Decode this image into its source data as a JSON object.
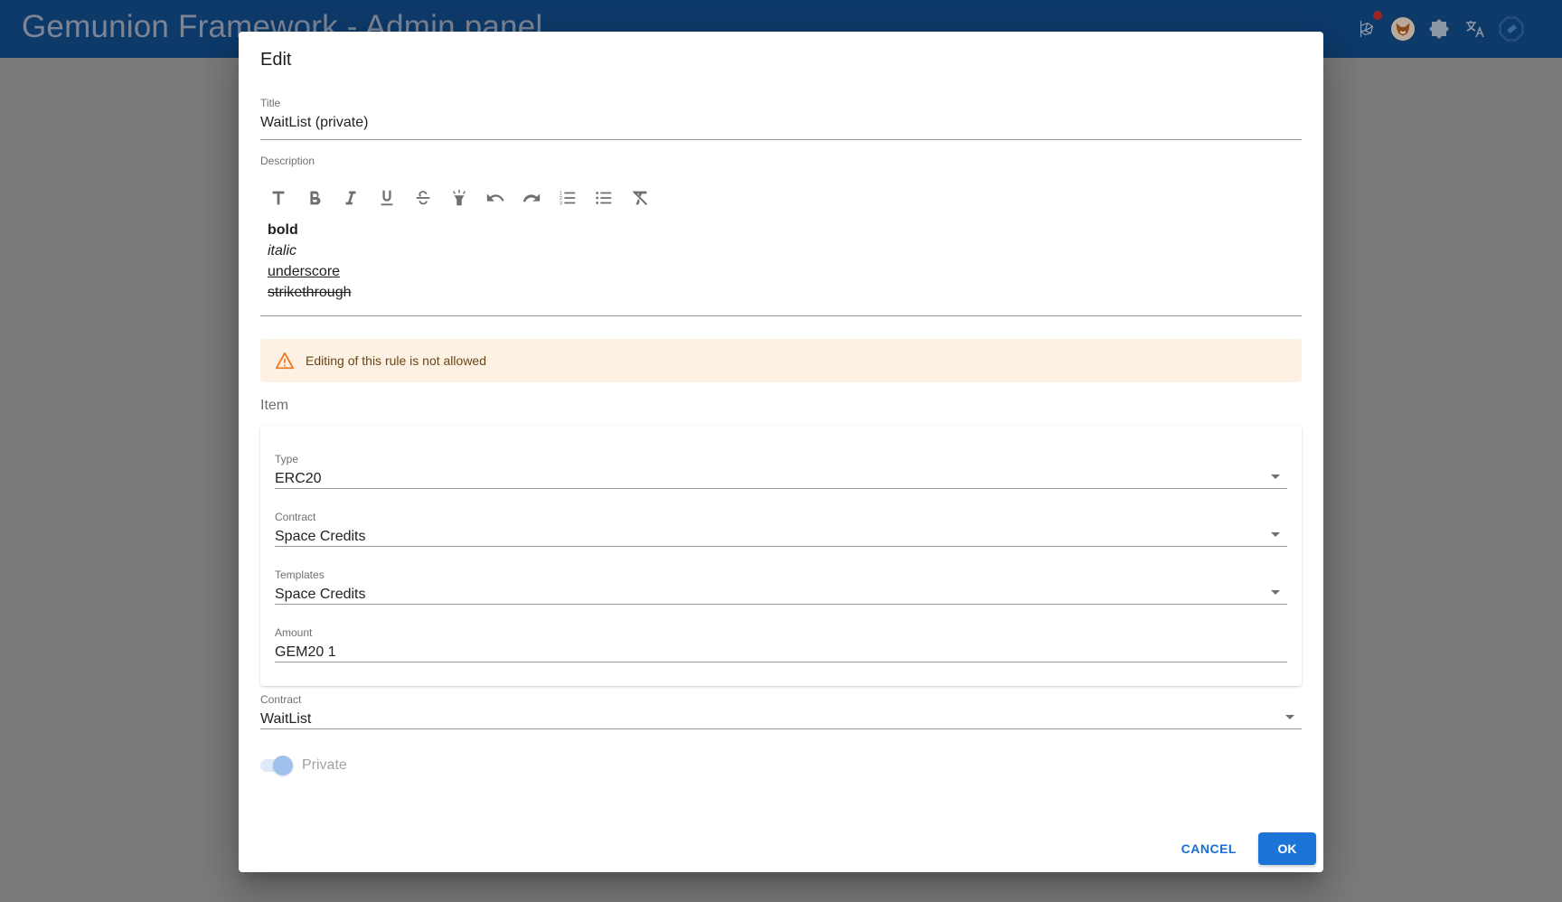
{
  "appbar": {
    "title": "Gemunion Framework - Admin panel",
    "icons": [
      "network-icon",
      "metamask-fox-icon",
      "theme-toggle-icon",
      "translate-icon",
      "wallet-icon"
    ],
    "notification_dot_color": "#9b2424"
  },
  "dialog": {
    "title": "Edit",
    "fields": {
      "title": {
        "label": "Title",
        "value": "WaitList (private)"
      },
      "description": {
        "label": "Description",
        "toolbar": [
          "text-style-icon",
          "bold-icon",
          "italic-icon",
          "underline-icon",
          "strikethrough-icon",
          "highlight-icon",
          "undo-icon",
          "redo-icon",
          "numbered-list-icon",
          "bulleted-list-icon",
          "clear-formatting-icon"
        ],
        "content": {
          "bold": "bold",
          "italic": "italic",
          "underline": "underscore",
          "strikethrough": "strikethrough"
        }
      }
    },
    "alert": {
      "severity": "warning",
      "text": "Editing of this rule is not allowed",
      "color": "#f07b24"
    },
    "item_section": {
      "title": "Item",
      "type": {
        "label": "Type",
        "value": "ERC20"
      },
      "contract": {
        "label": "Contract",
        "value": "Space Credits"
      },
      "templates": {
        "label": "Templates",
        "value": "Space Credits"
      },
      "amount": {
        "label": "Amount",
        "value": "GEM20 1"
      }
    },
    "contract": {
      "label": "Contract",
      "value": "WaitList"
    },
    "private_toggle": {
      "label": "Private",
      "checked": true,
      "disabled": true
    },
    "actions": {
      "cancel": "CANCEL",
      "ok": "OK"
    }
  },
  "colors": {
    "appbar": "#0e3a6a",
    "primary": "#1b74d6",
    "alert_bg": "#fdf1e3"
  }
}
